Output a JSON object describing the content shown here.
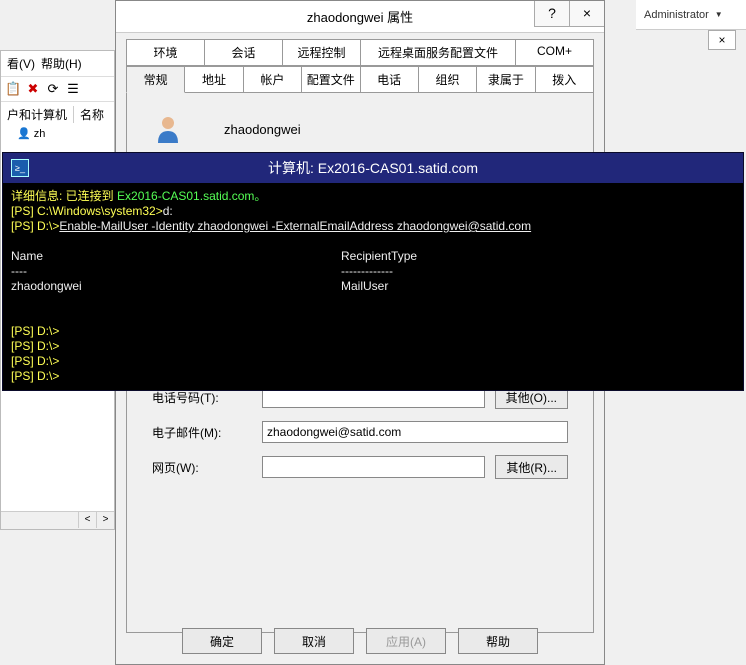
{
  "admin_label": "Administrator",
  "bg": {
    "menu_view": "看(V)",
    "menu_help": "帮助(H)",
    "tree_label": "户和计算机",
    "col_name": "名称",
    "row_user": "zh",
    "close_x": "×",
    "scroll_left": "<",
    "scroll_right": ">"
  },
  "dlg": {
    "title": "zhaodongwei 属性",
    "help_q": "?",
    "close_x": "×",
    "tabs_row1": [
      "环境",
      "会话",
      "远程控制",
      "远程桌面服务配置文件",
      "COM+"
    ],
    "tabs_row2": [
      "常规",
      "地址",
      "帐户",
      "配置文件",
      "电话",
      "组织",
      "隶属于",
      "拨入"
    ],
    "user_display": "zhaodongwei",
    "fields": {
      "phone_label": "电话号码(T):",
      "phone_value": "",
      "phone_other": "其他(O)...",
      "email_label": "电子邮件(M):",
      "email_value": "zhaodongwei@satid.com",
      "web_label": "网页(W):",
      "web_value": "",
      "web_other": "其他(R)..."
    },
    "buttons": {
      "ok": "确定",
      "cancel": "取消",
      "apply": "应用(A)",
      "help": "帮助"
    }
  },
  "ps": {
    "title": "计算机: Ex2016-CAS01.satid.com",
    "line1_pre": "详细信息: 已连接到 ",
    "line1_host": "Ex2016-CAS01.satid.com。",
    "prompt1_pre": "[PS] ",
    "prompt1_path": "C:\\Windows\\system32>",
    "prompt1_cmd": "d:",
    "prompt2_path": "D:\\>",
    "prompt2_cmd": "Enable-MailUser -Identity zhaodongwei -ExternalEmailAddress zhaodongwei@satid.com",
    "hdr_name": "Name",
    "hdr_type": "RecipientType",
    "dash_name": "----",
    "dash_type": "-------------",
    "row_name": "zhaodongwei",
    "row_type": "MailUser",
    "empty_prompt_path": "D:\\>"
  }
}
